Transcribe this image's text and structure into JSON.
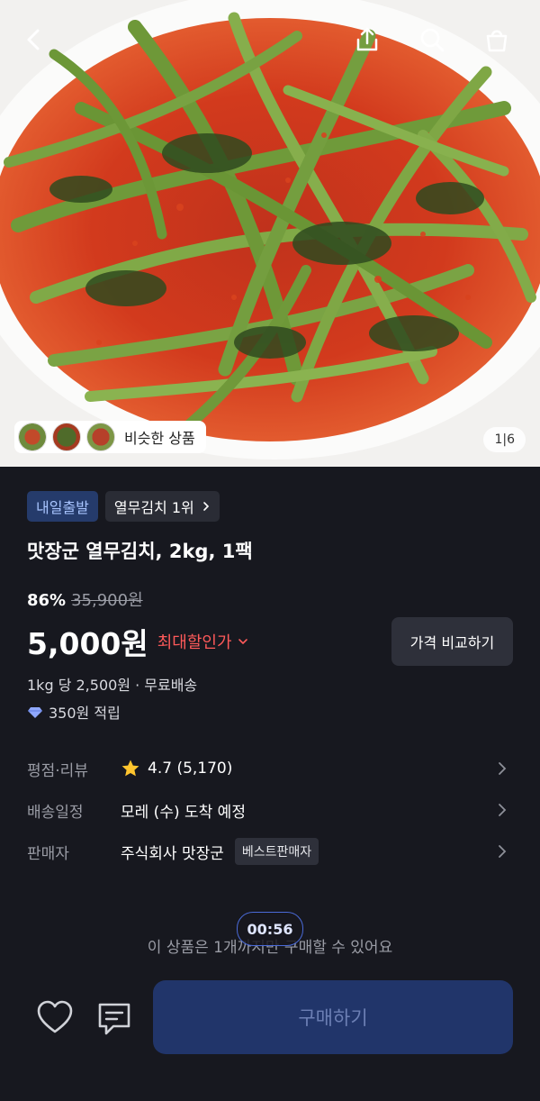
{
  "hero": {
    "similar_label": "비슷한 상품",
    "image_counter": "1|6"
  },
  "badges": {
    "shipping": "내일출발",
    "rank": "열무김치 1위"
  },
  "product": {
    "title": "맛장군 열무김치, 2kg, 1팩",
    "discount_rate": "86%",
    "original_price": "35,900원",
    "price": "5,000원",
    "max_discount": "최대할인가",
    "compare_button": "가격 비교하기",
    "unit_price_shipping": "1kg 당 2,500원 · 무료배송",
    "points": "350원 적립"
  },
  "info": {
    "rating_label": "평점·리뷰",
    "rating_value": "4.7 (5,170)",
    "delivery_label": "배송일정",
    "delivery_value": "모레 (수) 도착 예정",
    "seller_label": "판매자",
    "seller_value": "주식회사 맛장군",
    "seller_badge": "베스트판매자"
  },
  "purchase": {
    "limit_text": "이 상품은 1개까지만 구매할 수 있어요",
    "timer": "00:56",
    "buy_button": "구매하기"
  },
  "colors": {
    "background": "#17181f",
    "accent_red": "#ff5a5a",
    "buy_button_bg": "#21356a",
    "badge_blue_bg": "#253b6b"
  },
  "icons": [
    "back-icon",
    "share-icon",
    "search-icon",
    "cart-icon",
    "star-icon",
    "chevron-right-icon",
    "heart-icon",
    "chat-icon",
    "points-icon"
  ]
}
